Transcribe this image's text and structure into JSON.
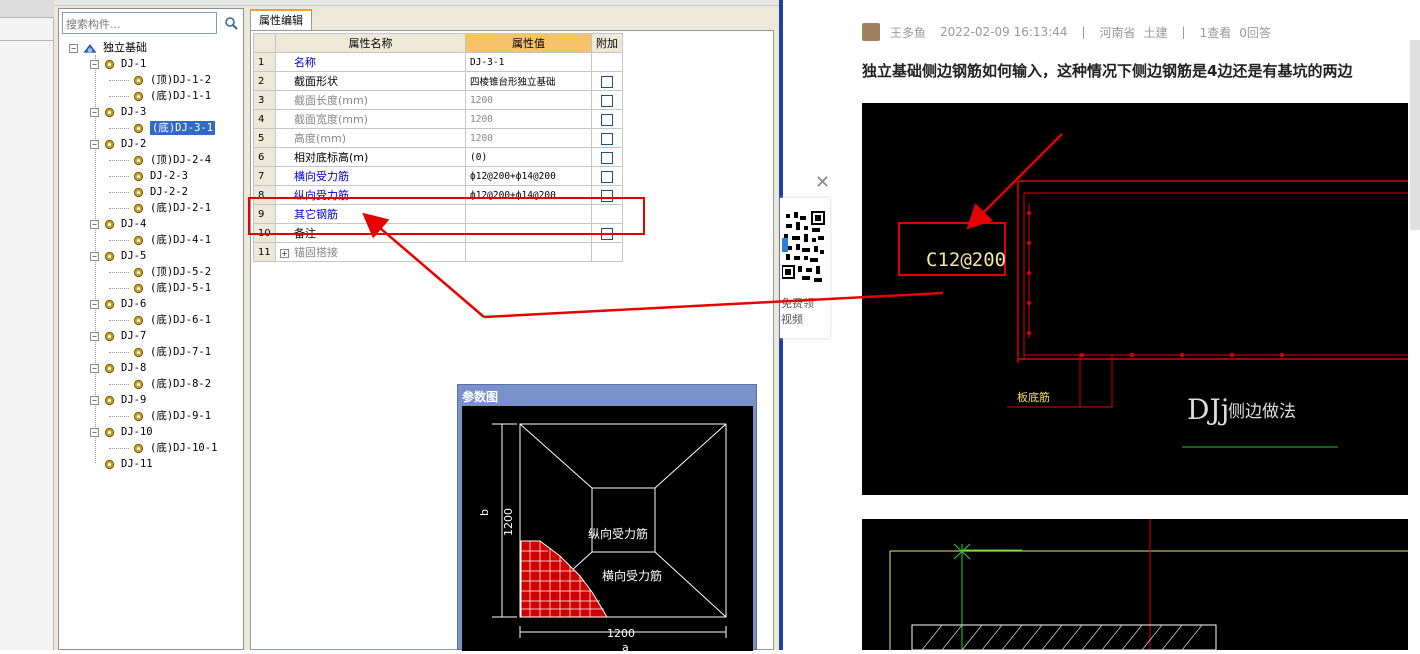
{
  "search": {
    "placeholder": "搜索构件..."
  },
  "tree": {
    "root": "独立基础",
    "items": [
      {
        "label": "DJ-1",
        "level": 1
      },
      {
        "label": "(顶)DJ-1-2",
        "level": 2
      },
      {
        "label": "(底)DJ-1-1",
        "level": 2
      },
      {
        "label": "DJ-3",
        "level": 1
      },
      {
        "label": "(底)DJ-3-1",
        "level": 2,
        "selected": true
      },
      {
        "label": "DJ-2",
        "level": 1
      },
      {
        "label": "(顶)DJ-2-4",
        "level": 2
      },
      {
        "label": "DJ-2-3",
        "level": 2
      },
      {
        "label": "DJ-2-2",
        "level": 2
      },
      {
        "label": "(底)DJ-2-1",
        "level": 2
      },
      {
        "label": "DJ-4",
        "level": 1
      },
      {
        "label": "(底)DJ-4-1",
        "level": 2
      },
      {
        "label": "DJ-5",
        "level": 1
      },
      {
        "label": "(顶)DJ-5-2",
        "level": 2
      },
      {
        "label": "(底)DJ-5-1",
        "level": 2
      },
      {
        "label": "DJ-6",
        "level": 1
      },
      {
        "label": "(底)DJ-6-1",
        "level": 2
      },
      {
        "label": "DJ-7",
        "level": 1
      },
      {
        "label": "(底)DJ-7-1",
        "level": 2
      },
      {
        "label": "DJ-8",
        "level": 1
      },
      {
        "label": "(底)DJ-8-2",
        "level": 2
      },
      {
        "label": "DJ-9",
        "level": 1
      },
      {
        "label": "(底)DJ-9-1",
        "level": 2
      },
      {
        "label": "DJ-10",
        "level": 1
      },
      {
        "label": "(底)DJ-10-1",
        "level": 2
      },
      {
        "label": "DJ-11",
        "level": 1,
        "leaf": true
      }
    ]
  },
  "tab": {
    "label": "属性编辑"
  },
  "grid": {
    "headers": {
      "name": "属性名称",
      "value": "属性值",
      "attach": "附加"
    },
    "rows": [
      {
        "num": "1",
        "name": "名称",
        "value": "DJ-3-1",
        "style": "blue",
        "check": false
      },
      {
        "num": "2",
        "name": "截面形状",
        "value": "四棱锥台形独立基础",
        "style": "",
        "check": true
      },
      {
        "num": "3",
        "name": "截面长度(mm)",
        "value": "1200",
        "style": "gray",
        "check": true
      },
      {
        "num": "4",
        "name": "截面宽度(mm)",
        "value": "1200",
        "style": "gray",
        "check": true
      },
      {
        "num": "5",
        "name": "高度(mm)",
        "value": "1200",
        "style": "gray",
        "check": true
      },
      {
        "num": "6",
        "name": "相对底标高(m)",
        "value": "(0)",
        "style": "",
        "check": true
      },
      {
        "num": "7",
        "name": "横向受力筋",
        "value": "ф12@200+ф14@200",
        "style": "blue",
        "check": true
      },
      {
        "num": "8",
        "name": "纵向受力筋",
        "value": "ф12@200+ф14@200",
        "style": "blue",
        "check": true
      },
      {
        "num": "9",
        "name": "其它钢筋",
        "value": "",
        "style": "blue",
        "check": false
      },
      {
        "num": "10",
        "name": "备注",
        "value": "",
        "style": "",
        "check": true
      },
      {
        "num": "11",
        "name": "锚固搭接",
        "value": "",
        "style": "gray",
        "check": false,
        "expander": "+"
      }
    ]
  },
  "param": {
    "title": "参数图",
    "label_long": "纵向受力筋",
    "label_trans": "横向受力筋",
    "dim_b": "b",
    "dim_1200_v": "1200",
    "dim_1200_h": "1200",
    "dim_a": "a"
  },
  "qr": {
    "line1": "免费领",
    "line2": "视频"
  },
  "post": {
    "author": "王多鱼",
    "time": "2022-02-09 16:13:44",
    "region": "河南省",
    "category": "土建",
    "views": "1查看",
    "replies": "0回答",
    "title": "独立基础侧边钢筋如何输入，这种情况下侧边钢筋是4边还是有基坑的两边"
  },
  "cad": {
    "label": "C12@200",
    "caption_main": "DJj",
    "caption_sub": "侧边做法",
    "small_label": "板底筋"
  },
  "colors": {
    "accent_red": "#e60000",
    "tab_highlight": "#f7c26b",
    "divider": "#1c3fa8"
  }
}
